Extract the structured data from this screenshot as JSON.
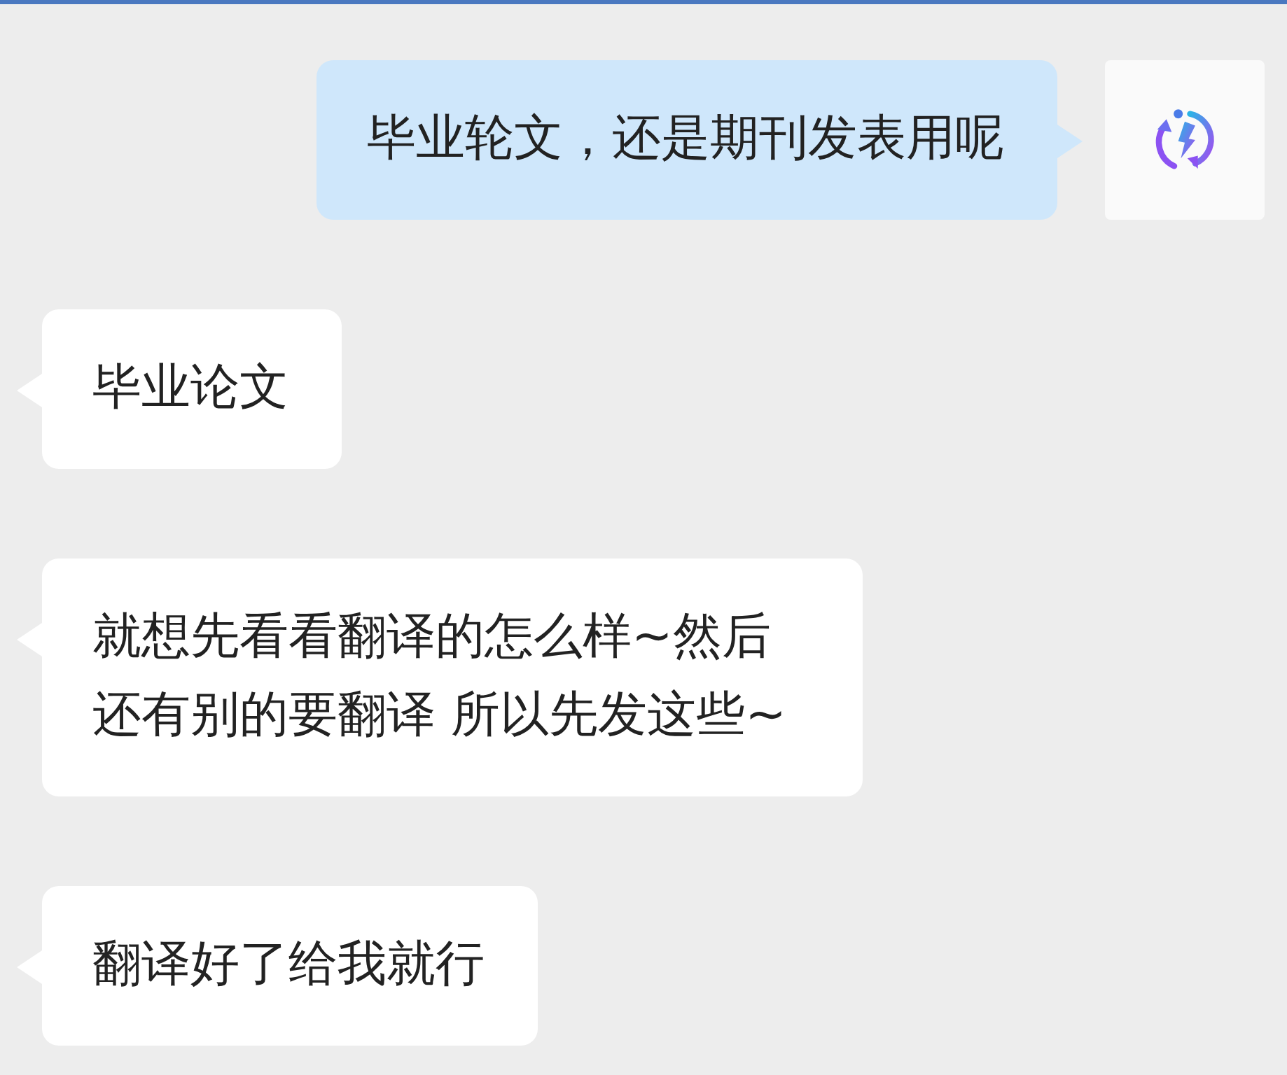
{
  "messages": [
    {
      "kind": "sent",
      "text": "毕业轮文，还是期刊发表用呢"
    },
    {
      "kind": "received",
      "text": "毕业论文"
    },
    {
      "kind": "received",
      "text": "就想先看看翻译的怎么样~然后还有别的要翻译 所以先发这些~"
    },
    {
      "kind": "received",
      "text": "翻译好了给我就行"
    }
  ]
}
